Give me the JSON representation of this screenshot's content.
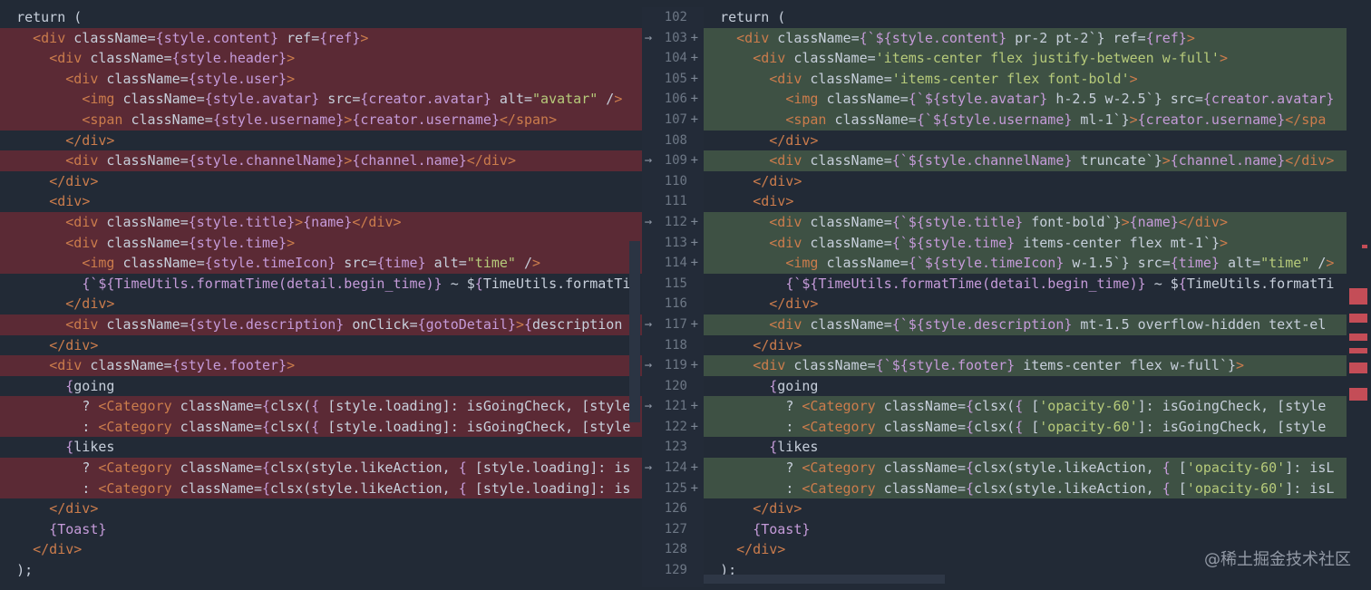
{
  "app": {
    "view": "split diff"
  },
  "watermark": "@稀土掘金技术社区",
  "left_lines": [
    {
      "i": 0,
      "changed": false,
      "t": "return ("
    },
    {
      "i": 1,
      "changed": true,
      "t": "<div className={style.content} ref={ref}>"
    },
    {
      "i": 2,
      "changed": true,
      "t": "<div className={style.header}>"
    },
    {
      "i": 3,
      "changed": true,
      "t": "<div className={style.user}>"
    },
    {
      "i": 4,
      "changed": true,
      "t": "<img className={style.avatar} src={creator.avatar} alt=\"avatar\" />"
    },
    {
      "i": 4,
      "changed": true,
      "t": "<span className={style.username}>{creator.username}</span>"
    },
    {
      "i": 3,
      "changed": false,
      "t": "</div>"
    },
    {
      "i": 3,
      "changed": true,
      "t": "<div className={style.channelName}>{channel.name}</div>"
    },
    {
      "i": 2,
      "changed": false,
      "t": "</div>"
    },
    {
      "i": 2,
      "changed": false,
      "t": "<div>"
    },
    {
      "i": 3,
      "changed": true,
      "t": "<div className={style.title}>{name}</div>"
    },
    {
      "i": 3,
      "changed": true,
      "t": "<div className={style.time}>"
    },
    {
      "i": 4,
      "changed": true,
      "t": "<img className={style.timeIcon} src={time} alt=\"time\" />"
    },
    {
      "i": 4,
      "changed": false,
      "t": "{`${TimeUtils.formatTime(detail.begin_time)} ~ ${TimeUtils.formatTi"
    },
    {
      "i": 3,
      "changed": false,
      "t": "</div>"
    },
    {
      "i": 3,
      "changed": true,
      "t": "<div className={style.description} onClick={gotoDetail}>{description"
    },
    {
      "i": 2,
      "changed": false,
      "t": "</div>"
    },
    {
      "i": 2,
      "changed": true,
      "t": "<div className={style.footer}>"
    },
    {
      "i": 3,
      "changed": false,
      "t": "{going"
    },
    {
      "i": 4,
      "changed": true,
      "t": "? <Category className={clsx({ [style.loading]: isGoingCheck, [style"
    },
    {
      "i": 4,
      "changed": true,
      "t": ": <Category className={clsx({ [style.loading]: isGoingCheck, [style"
    },
    {
      "i": 3,
      "changed": false,
      "t": "{likes"
    },
    {
      "i": 4,
      "changed": true,
      "t": "? <Category className={clsx(style.likeAction, { [style.loading]: is"
    },
    {
      "i": 4,
      "changed": true,
      "t": ": <Category className={clsx(style.likeAction, { [style.loading]: is"
    },
    {
      "i": 2,
      "changed": false,
      "t": "</div>"
    },
    {
      "i": 2,
      "changed": false,
      "t": "{Toast}"
    },
    {
      "i": 1,
      "changed": false,
      "t": "</div>"
    },
    {
      "i": 0,
      "changed": false,
      "t": ");"
    }
  ],
  "right_lines": [
    {
      "i": 0,
      "changed": false,
      "t": "return ("
    },
    {
      "i": 1,
      "changed": true,
      "t": "<div className={`${style.content} pr-2 pt-2`} ref={ref}>"
    },
    {
      "i": 2,
      "changed": true,
      "t": "<div className='items-center flex justify-between w-full'>"
    },
    {
      "i": 3,
      "changed": true,
      "t": "<div className='items-center flex font-bold'>"
    },
    {
      "i": 4,
      "changed": true,
      "t": "<img className={`${style.avatar} h-2.5 w-2.5`} src={creator.avatar}"
    },
    {
      "i": 4,
      "changed": true,
      "t": "<span className={`${style.username} ml-1`}>{creator.username}</spa"
    },
    {
      "i": 3,
      "changed": false,
      "t": "</div>"
    },
    {
      "i": 3,
      "changed": true,
      "t": "<div className={`${style.channelName} truncate`}>{channel.name}</div>"
    },
    {
      "i": 2,
      "changed": false,
      "t": "</div>"
    },
    {
      "i": 2,
      "changed": false,
      "t": "<div>"
    },
    {
      "i": 3,
      "changed": true,
      "t": "<div className={`${style.title} font-bold`}>{name}</div>"
    },
    {
      "i": 3,
      "changed": true,
      "t": "<div className={`${style.time} items-center flex mt-1`}>"
    },
    {
      "i": 4,
      "changed": true,
      "t": "<img className={`${style.timeIcon} w-1.5`} src={time} alt=\"time\" />"
    },
    {
      "i": 4,
      "changed": false,
      "t": "{`${TimeUtils.formatTime(detail.begin_time)} ~ ${TimeUtils.formatTi"
    },
    {
      "i": 3,
      "changed": false,
      "t": "</div>"
    },
    {
      "i": 3,
      "changed": true,
      "t": "<div className={`${style.description} mt-1.5 overflow-hidden text-el"
    },
    {
      "i": 2,
      "changed": false,
      "t": "</div>"
    },
    {
      "i": 2,
      "changed": true,
      "t": "<div className={`${style.footer} items-center flex w-full`}>"
    },
    {
      "i": 3,
      "changed": false,
      "t": "{going"
    },
    {
      "i": 4,
      "changed": true,
      "t": "? <Category className={clsx({ ['opacity-60']: isGoingCheck, [style"
    },
    {
      "i": 4,
      "changed": true,
      "t": ": <Category className={clsx({ ['opacity-60']: isGoingCheck, [style"
    },
    {
      "i": 3,
      "changed": false,
      "t": "{likes"
    },
    {
      "i": 4,
      "changed": true,
      "t": "? <Category className={clsx(style.likeAction, { ['opacity-60']: isL"
    },
    {
      "i": 4,
      "changed": true,
      "t": ": <Category className={clsx(style.likeAction, { ['opacity-60']: isL"
    },
    {
      "i": 2,
      "changed": false,
      "t": "</div>"
    },
    {
      "i": 2,
      "changed": false,
      "t": "{Toast}"
    },
    {
      "i": 1,
      "changed": false,
      "t": "</div>"
    },
    {
      "i": 0,
      "changed": false,
      "t": ");"
    }
  ],
  "gutter": [
    {
      "ln": "102",
      "plus": "",
      "arrow": ""
    },
    {
      "ln": "103",
      "plus": "+",
      "arrow": "→"
    },
    {
      "ln": "104",
      "plus": "+",
      "arrow": ""
    },
    {
      "ln": "105",
      "plus": "+",
      "arrow": ""
    },
    {
      "ln": "106",
      "plus": "+",
      "arrow": ""
    },
    {
      "ln": "107",
      "plus": "+",
      "arrow": ""
    },
    {
      "ln": "108",
      "plus": "",
      "arrow": ""
    },
    {
      "ln": "109",
      "plus": "+",
      "arrow": "→"
    },
    {
      "ln": "110",
      "plus": "",
      "arrow": ""
    },
    {
      "ln": "111",
      "plus": "",
      "arrow": ""
    },
    {
      "ln": "112",
      "plus": "+",
      "arrow": "→"
    },
    {
      "ln": "113",
      "plus": "+",
      "arrow": ""
    },
    {
      "ln": "114",
      "plus": "+",
      "arrow": ""
    },
    {
      "ln": "115",
      "plus": "",
      "arrow": ""
    },
    {
      "ln": "116",
      "plus": "",
      "arrow": ""
    },
    {
      "ln": "117",
      "plus": "+",
      "arrow": "→"
    },
    {
      "ln": "118",
      "plus": "",
      "arrow": ""
    },
    {
      "ln": "119",
      "plus": "+",
      "arrow": "→"
    },
    {
      "ln": "120",
      "plus": "",
      "arrow": ""
    },
    {
      "ln": "121",
      "plus": "+",
      "arrow": "→"
    },
    {
      "ln": "122",
      "plus": "+",
      "arrow": ""
    },
    {
      "ln": "123",
      "plus": "",
      "arrow": ""
    },
    {
      "ln": "124",
      "plus": "+",
      "arrow": "→"
    },
    {
      "ln": "125",
      "plus": "+",
      "arrow": ""
    },
    {
      "ln": "126",
      "plus": "",
      "arrow": ""
    },
    {
      "ln": "127",
      "plus": "",
      "arrow": ""
    },
    {
      "ln": "128",
      "plus": "",
      "arrow": ""
    },
    {
      "ln": "129",
      "plus": "",
      "arrow": ""
    }
  ],
  "colors": {
    "background": "#222a36",
    "removed_line": "#5b2a35",
    "added_line": "#3e5144",
    "tag": "#cb7c4c",
    "attr": "#e6c171",
    "string": "#b6ca7a",
    "expr": "#c59bd9"
  }
}
